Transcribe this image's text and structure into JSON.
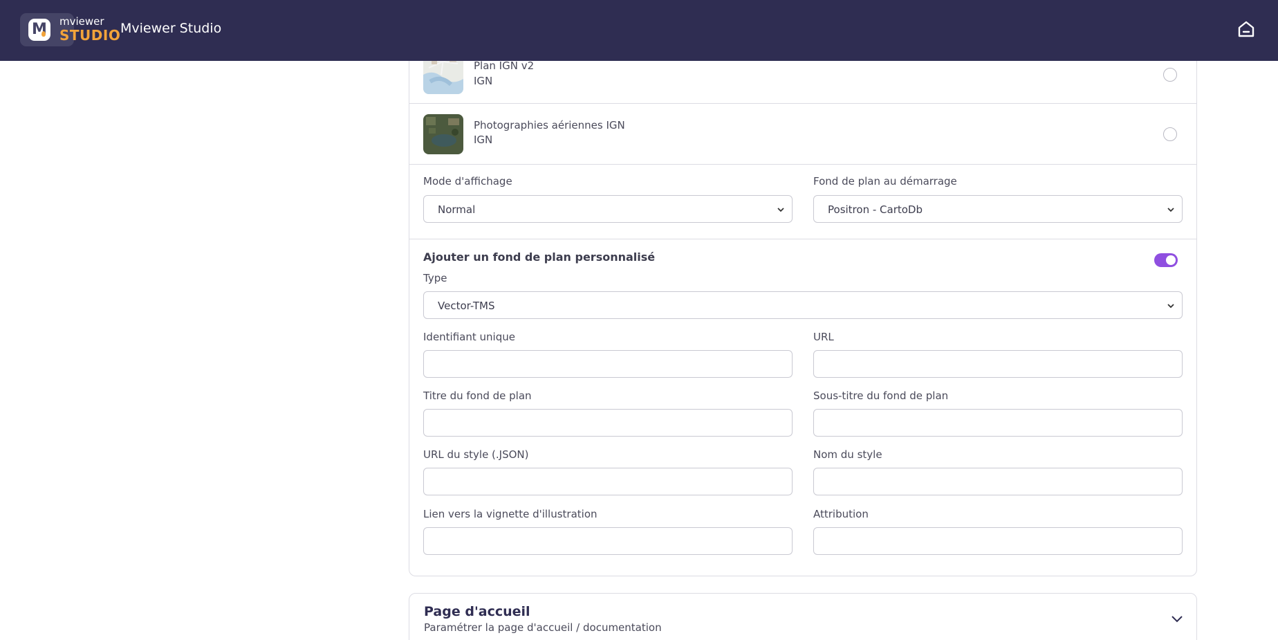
{
  "header": {
    "logo_line1": "mviewer",
    "logo_line2": "STUDIO",
    "app_title": "Mviewer Studio"
  },
  "basemaps": [
    {
      "name": "Plan IGN v2",
      "source": "IGN",
      "selected": false
    },
    {
      "name": "Photographies aériennes IGN",
      "source": "IGN",
      "selected": false
    }
  ],
  "display": {
    "mode_label": "Mode d'affichage",
    "mode_value": "Normal",
    "startup_label": "Fond de plan au démarrage",
    "startup_value": "Positron - CartoDb"
  },
  "custom": {
    "title": "Ajouter un fond de plan personnalisé",
    "enabled": true,
    "type_label": "Type",
    "type_value": "Vector-TMS",
    "fields": {
      "id_label": "Identifiant unique",
      "url_label": "URL",
      "title_label": "Titre du fond de plan",
      "subtitle_label": "Sous-titre du fond de plan",
      "style_url_label": "URL du style (.JSON)",
      "style_name_label": "Nom du style",
      "thumb_label": "Lien vers la vignette d'illustration",
      "attribution_label": "Attribution"
    }
  },
  "homepage": {
    "title": "Page d'accueil",
    "subtitle": "Paramétrer la page d'accueil / documentation"
  },
  "colors": {
    "header_bg": "#2f2d52",
    "accent_orange": "#f2a33a",
    "toggle_purple": "#8f4fe0"
  }
}
